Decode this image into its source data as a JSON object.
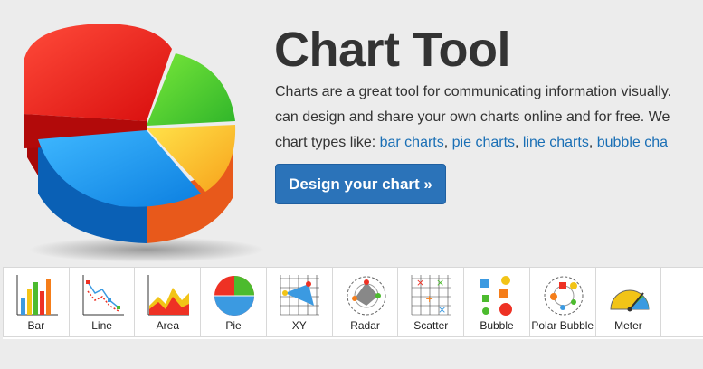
{
  "hero": {
    "title": "Chart Tool",
    "desc_line1": "Charts are a great tool for communicating information visually.",
    "desc_line2": "can design and share your own charts online and for free. We",
    "desc_line3_prefix": "chart types like: ",
    "links": [
      "bar charts",
      "pie charts",
      "line charts",
      "bubble cha"
    ],
    "sep1": ", ",
    "sep2": ", ",
    "sep3": ", ",
    "cta_label": "Design your chart »"
  },
  "chart_types": [
    {
      "label": "Bar",
      "icon": "bar-chart-icon"
    },
    {
      "label": "Line",
      "icon": "line-chart-icon"
    },
    {
      "label": "Area",
      "icon": "area-chart-icon"
    },
    {
      "label": "Pie",
      "icon": "pie-chart-icon"
    },
    {
      "label": "XY",
      "icon": "xy-chart-icon"
    },
    {
      "label": "Radar",
      "icon": "radar-chart-icon"
    },
    {
      "label": "Scatter",
      "icon": "scatter-chart-icon"
    },
    {
      "label": "Bubble",
      "icon": "bubble-chart-icon"
    },
    {
      "label": "Polar Bubble",
      "icon": "polar-bubble-chart-icon"
    },
    {
      "label": "Meter",
      "icon": "meter-chart-icon"
    }
  ],
  "colors": {
    "accent": "#2b73b9",
    "link": "#1a6fb5"
  }
}
